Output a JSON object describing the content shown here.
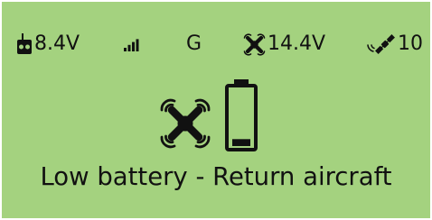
{
  "status_bar": {
    "remote_controller": {
      "icon": "remote-controller-icon",
      "voltage": "8.4V"
    },
    "signal": {
      "icon": "signal-strength-icon",
      "level_bars": 4,
      "max_bars": 5
    },
    "gps_mode": "G",
    "aircraft": {
      "icon": "aircraft-drone-icon",
      "voltage": "14.4V"
    },
    "satellites": {
      "icon": "satellite-icon",
      "count": "10"
    }
  },
  "center": {
    "drone_icon": "aircraft-drone-icon",
    "battery_icon": "battery-low-icon",
    "battery_level": 0.12
  },
  "message": "Low battery - Return aircraft",
  "colors": {
    "screen_background": "#a4d27f",
    "foreground": "#111111"
  }
}
